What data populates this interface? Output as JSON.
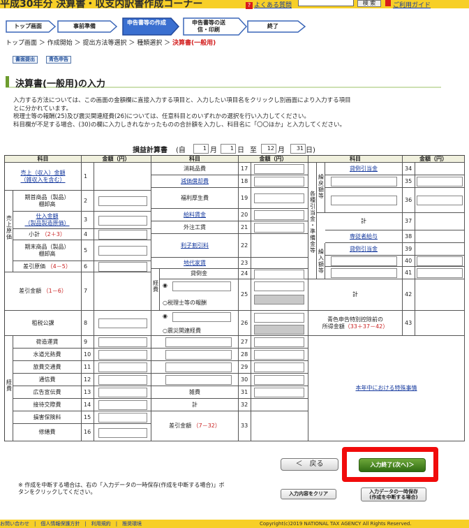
{
  "header": {
    "title": "平成30年分 決算書・収支内訳書作成コーナー",
    "faq": "よくある質問",
    "search_button": "検 索",
    "guide": "ご利用ガイド"
  },
  "steps": [
    "トップ画面",
    "事前準備",
    "申告書等の作成",
    "申告書等の送信・印刷",
    "終了"
  ],
  "breadcrumb": {
    "items": [
      "トップ画面",
      "作成開始",
      "提出方法等選択",
      "種類選択"
    ],
    "current": "決算書(一般用)"
  },
  "small_buttons": [
    "書面提出",
    "青色申告"
  ],
  "section_title": "決算書(一般用)の入力",
  "intro": [
    "入力する方法については、この画面の金額欄に直接入力する項目と、入力したい項目名をクリックし別画面により入力する項目",
    "とに分かれています。",
    "税理士等の報酬(25)及び震災関連経費(26)については、任意科目とのいずれかの選択を行い入力してください。",
    "科目欄が不足する場合、(30)の欄に入力しきれなかったものの合計額を入力し、科目名に「〇〇ほか」と入力してください。"
  ],
  "period": {
    "title": "損益計算書",
    "open": "(自",
    "m1": "1",
    "mlabel": "月",
    "d1": "1",
    "dlabel": "日",
    "sep": "至",
    "m2": "12",
    "d2": "31",
    "close": "日)"
  },
  "table_header": {
    "item": "科目",
    "amount": "金額（円）"
  },
  "col1": {
    "side_sales_cost": "売上原価",
    "side_expenses": "経費",
    "rows": [
      {
        "label": "売上（収入）金額",
        "sub": "（雑収入を含む）",
        "no": "1"
      },
      {
        "label": "期首商品（製品）",
        "sub": "棚卸高",
        "no": "2"
      },
      {
        "label": "仕入金額",
        "sub": "（製品製造原価）",
        "no": "3"
      },
      {
        "label": "小計",
        "formula": "（2＋3）",
        "no": "4"
      },
      {
        "label": "期末商品（製品）",
        "sub": "棚卸高",
        "no": "5"
      },
      {
        "label": "差引原価",
        "formula": "（4－5）",
        "no": "6"
      },
      {
        "label": "差引金額",
        "formula": "（1－6）",
        "no": "7"
      },
      {
        "label": "租税公課",
        "no": "8"
      },
      {
        "label": "荷造運賃",
        "no": "9"
      },
      {
        "label": "水道光熱費",
        "no": "10"
      },
      {
        "label": "旅費交通費",
        "no": "11"
      },
      {
        "label": "通信費",
        "no": "12"
      },
      {
        "label": "広告宣伝費",
        "no": "13"
      },
      {
        "label": "接待交際費",
        "no": "14"
      },
      {
        "label": "損害保険料",
        "no": "15"
      },
      {
        "label": "修繕費",
        "no": "16"
      }
    ]
  },
  "col2": {
    "side_expenses": "経費",
    "rows": [
      {
        "label": "消耗品費",
        "no": "17"
      },
      {
        "label": "減価償却費",
        "no": "18"
      },
      {
        "label": "福利厚生費",
        "no": "19"
      },
      {
        "label": "給料賃金",
        "no": "20"
      },
      {
        "label": "外注工賃",
        "no": "21"
      },
      {
        "label": "利子割引料",
        "no": "22"
      },
      {
        "label": "地代家賃",
        "no": "23"
      },
      {
        "label": "貸倒金",
        "no": "24"
      },
      {
        "label": "税理士等の報酬",
        "no": "25"
      },
      {
        "label": "震災関連経費",
        "no": "26"
      },
      {
        "no": "27"
      },
      {
        "no": "28"
      },
      {
        "no": "29"
      },
      {
        "no": "30"
      },
      {
        "label": "雑費",
        "no": "31"
      },
      {
        "label": "計",
        "no": "32"
      },
      {
        "label": "差引金額",
        "formula": "（7－32）",
        "no": "33"
      }
    ]
  },
  "col3": {
    "side_reserve": "各種引当金・準備金等",
    "side_transfer_out": "繰戻額等",
    "side_transfer_in": "繰入額等",
    "rows": [
      {
        "label": "貸倒引当金",
        "no": "34"
      },
      {
        "no": "35"
      },
      {
        "no": "36"
      },
      {
        "label": "計",
        "no": "37"
      },
      {
        "label": "専従者給与",
        "no": "38"
      },
      {
        "label": "貸倒引当金",
        "no": "39"
      },
      {
        "no": "40"
      },
      {
        "no": "41"
      },
      {
        "label": "計",
        "no": "42"
      },
      {
        "label": "青色申告特別控除前の",
        "sub": "所得金額",
        "formula": "（33＋37－42）",
        "no": "43"
      }
    ],
    "special": "本年中における特殊事情"
  },
  "buttons": {
    "back": "＜　戻る",
    "next": "入力終了(次へ)＞",
    "clear": "入力内容をクリア",
    "save_line1": "入力データの一時保存",
    "save_line2": "(作成を中断する場合)"
  },
  "note": {
    "mark": "※",
    "text": "作成を中断する場合は、右の「入力データの一時保存(作成を中断する場合)」ボタンをクリックしてください。"
  },
  "footer": {
    "links": "お問い合わせ　|　個人情報保護方針　|　利用規約　|　推奨環境",
    "copyright": "Copyright(c)2019 NATIONAL TAX AGENCY All Rights Reserved."
  },
  "colors": {
    "topbar": "#f7cf27",
    "step_active": "#3a6fd0",
    "section_accent": "#6d9c2e",
    "highlight": "#f10b0b",
    "next_button": "#3f7d1c",
    "link": "#15399e"
  }
}
